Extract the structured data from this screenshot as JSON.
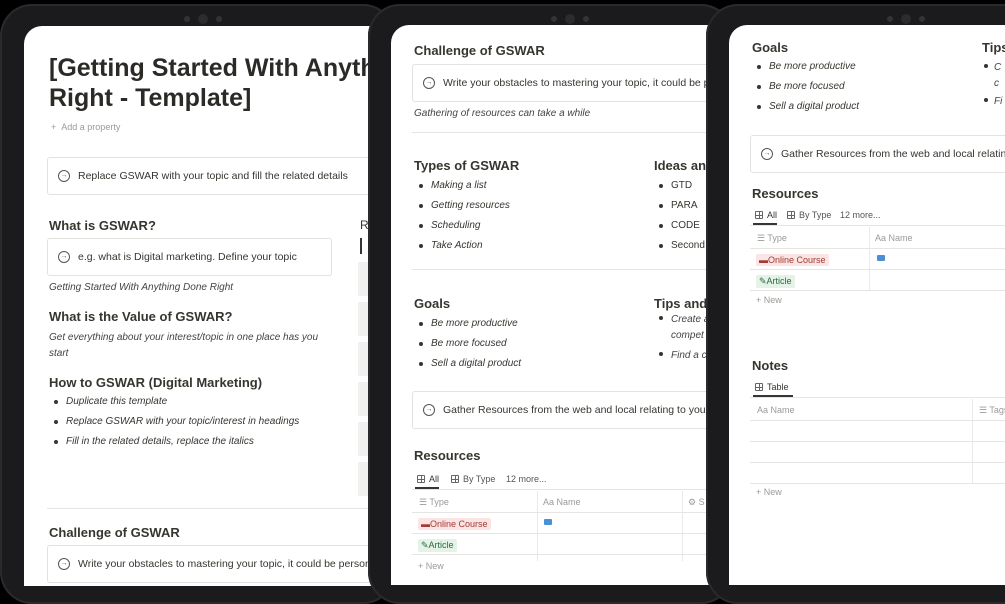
{
  "left": {
    "title_line1": "[Getting Started With Anyth",
    "title_line2": "Right - Template]",
    "add_property": "Add a property",
    "callout_top": "Replace GSWAR with your topic and fill the related details",
    "what_heading": "What is GSWAR?",
    "what_callout": "e.g. what is Digital marketing. Define your topic",
    "what_text": "Getting Started With Anything Done Right",
    "value_heading": "What is the Value of GSWAR?",
    "value_text_1": "Get everything about your interest/topic in one place has you",
    "value_text_2": "start",
    "how_heading": "How to GSWAR (Digital Marketing)",
    "how_items": [
      "Duplicate this template",
      "Replace GSWAR with your topic/interest in headings",
      "Fill in the related details, replace the italics"
    ],
    "side_letter": "R",
    "challenge_heading": "Challenge of GSWAR",
    "challenge_callout": "Write your obstacles to mastering your topic, it could be personal"
  },
  "middle": {
    "challenge_heading": "Challenge of GSWAR",
    "challenge_callout": "Write your obstacles to mastering your topic, it could be pe",
    "challenge_text": "Gathering of resources can take a while",
    "types_heading": "Types of GSWAR",
    "types_items": [
      "Making a list",
      "Getting resources",
      "Scheduling",
      "Take Action"
    ],
    "ideas_heading": "Ideas and",
    "ideas_items": [
      "GTD",
      "PARA",
      "CODE",
      "Second"
    ],
    "goals_heading": "Goals",
    "goals_items": [
      "Be more productive",
      "Be more focused",
      "Sell a digital product"
    ],
    "tips_heading": "Tips and",
    "tips_items": [
      "Create a",
      "compet",
      "Find a c"
    ],
    "gather_callout": "Gather Resources from the web and local relating to your t",
    "resources_heading": "Resources",
    "tab_all": "All",
    "tab_bytype": "By Type",
    "tab_more": "12 more...",
    "col_type": "Type",
    "col_name": "Name",
    "row1_type": "Online Course",
    "row2_type": "Article",
    "new_label": "New"
  },
  "right": {
    "goals_heading": "Goals",
    "goals_items": [
      "Be more productive",
      "Be more focused",
      "Sell a digital product"
    ],
    "tips_heading": "Tips",
    "tips_items": [
      "C",
      "c",
      "Fi"
    ],
    "gather_callout": "Gather Resources from the web and local relating to",
    "resources_heading": "Resources",
    "tab_all": "All",
    "tab_bytype": "By Type",
    "tab_more": "12 more...",
    "col_type": "Type",
    "col_name": "Name",
    "row1_type": "Online Course",
    "row2_type": "Article",
    "new_label": "New",
    "notes_heading": "Notes",
    "notes_tab": "Table",
    "notes_col_name": "Name",
    "notes_col_tags": "Tags",
    "notes_new": "New"
  }
}
